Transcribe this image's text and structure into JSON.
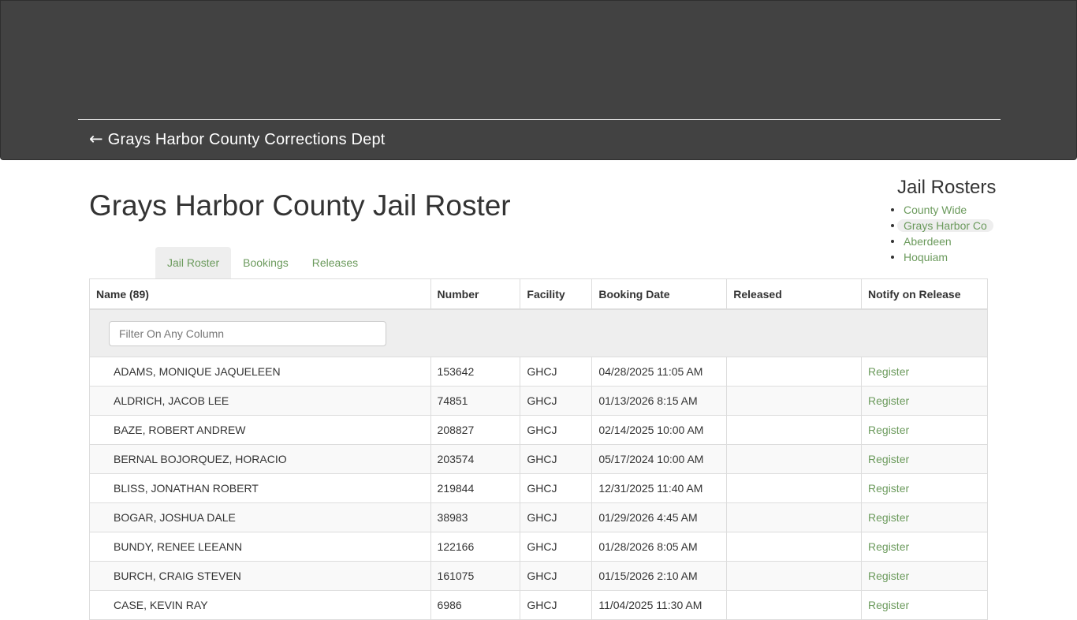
{
  "header": {
    "back_arrow": "←",
    "back_label": "Grays Harbor County Corrections Dept"
  },
  "page": {
    "title": "Grays Harbor County Jail Roster"
  },
  "rosters": {
    "title": "Jail Rosters",
    "items": [
      {
        "label": "County Wide",
        "active": false
      },
      {
        "label": "Grays Harbor Co",
        "active": true
      },
      {
        "label": "Aberdeen",
        "active": false
      },
      {
        "label": "Hoquiam",
        "active": false
      }
    ]
  },
  "tabs": [
    {
      "label": "Jail Roster",
      "active": true
    },
    {
      "label": "Bookings",
      "active": false
    },
    {
      "label": "Releases",
      "active": false
    }
  ],
  "table": {
    "columns": [
      "Name (89)",
      "Number",
      "Facility",
      "Booking Date",
      "Released",
      "Notify on Release"
    ],
    "filter_placeholder": "Filter On Any Column",
    "filter_value": "",
    "rows": [
      {
        "name": "ADAMS, MONIQUE JAQUELEEN",
        "number": "153642",
        "facility": "GHCJ",
        "booking_date": "04/28/2025 11:05 AM",
        "released": "",
        "notify": "Register"
      },
      {
        "name": "ALDRICH, JACOB LEE",
        "number": "74851",
        "facility": "GHCJ",
        "booking_date": "01/13/2026 8:15 AM",
        "released": "",
        "notify": "Register"
      },
      {
        "name": "BAZE, ROBERT ANDREW",
        "number": "208827",
        "facility": "GHCJ",
        "booking_date": "02/14/2025 10:00 AM",
        "released": "",
        "notify": "Register"
      },
      {
        "name": "BERNAL BOJORQUEZ, HORACIO",
        "number": "203574",
        "facility": "GHCJ",
        "booking_date": "05/17/2024 10:00 AM",
        "released": "",
        "notify": "Register"
      },
      {
        "name": "BLISS, JONATHAN ROBERT",
        "number": "219844",
        "facility": "GHCJ",
        "booking_date": "12/31/2025 11:40 AM",
        "released": "",
        "notify": "Register"
      },
      {
        "name": "BOGAR, JOSHUA DALE",
        "number": "38983",
        "facility": "GHCJ",
        "booking_date": "01/29/2026 4:45 AM",
        "released": "",
        "notify": "Register"
      },
      {
        "name": "BUNDY, RENEE LEEANN",
        "number": "122166",
        "facility": "GHCJ",
        "booking_date": "01/28/2026 8:05 AM",
        "released": "",
        "notify": "Register"
      },
      {
        "name": "BURCH, CRAIG STEVEN",
        "number": "161075",
        "facility": "GHCJ",
        "booking_date": "01/15/2026 2:10 AM",
        "released": "",
        "notify": "Register"
      },
      {
        "name": "CASE, KEVIN RAY",
        "number": "6986",
        "facility": "GHCJ",
        "booking_date": "11/04/2025 11:30 AM",
        "released": "",
        "notify": "Register"
      }
    ]
  },
  "colors": {
    "header_bg": "#424242",
    "link_green": "#6b9a5c",
    "active_bg": "#eeeeee"
  }
}
